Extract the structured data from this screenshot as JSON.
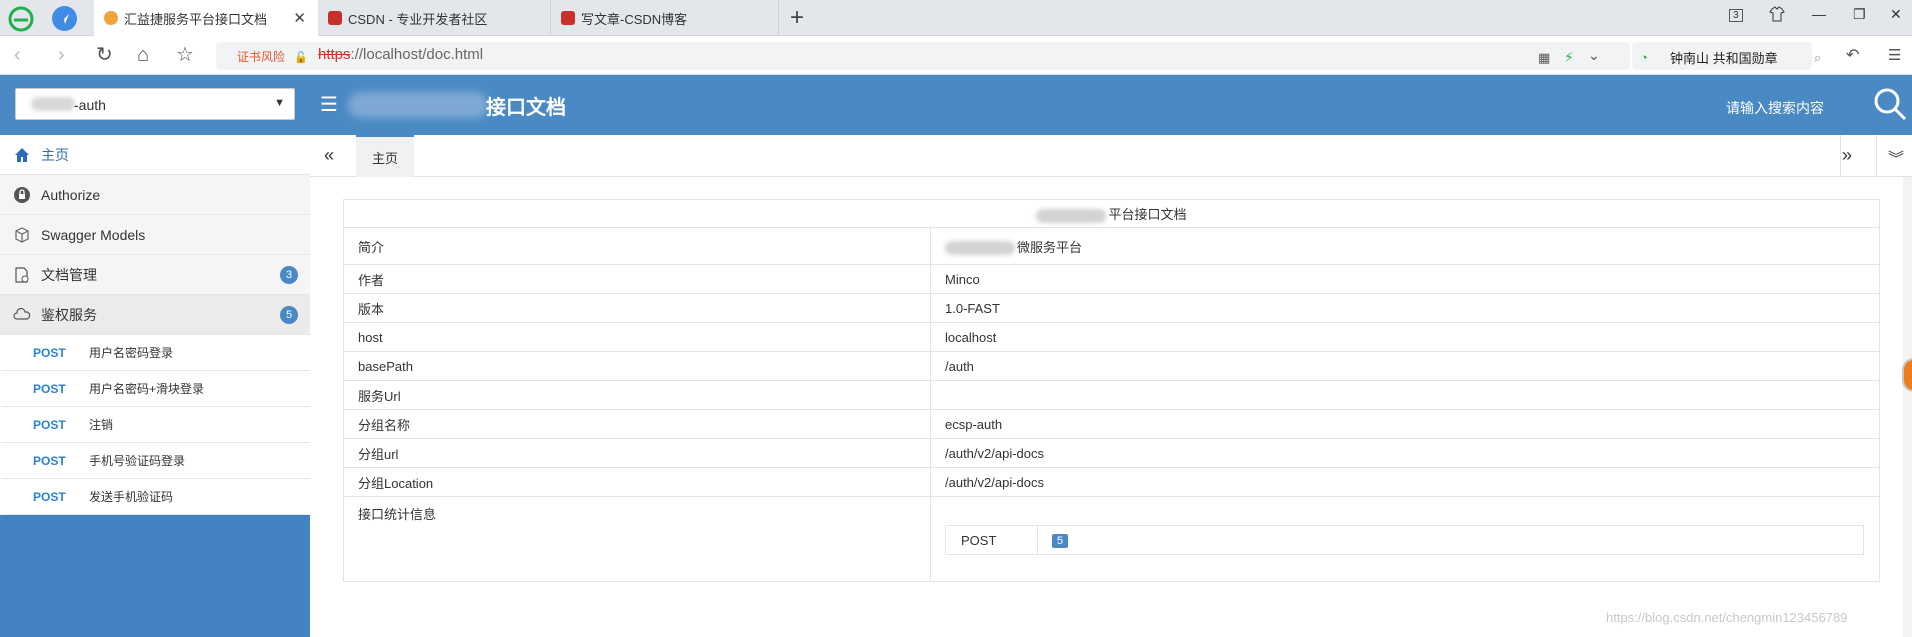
{
  "browser": {
    "tabs": [
      {
        "title": "汇益捷服务平台接口文档",
        "active": true
      },
      {
        "title": "CSDN - 专业开发者社区"
      },
      {
        "title": "写文章-CSDN博客"
      }
    ],
    "tab_count": "3",
    "cert_warning": "证书风险",
    "url_scheme": "https",
    "url_rest": "://localhost/doc.html",
    "search_hint": "钟南山 共和国勋章",
    "colors": {
      "favicon_csdn": "#c9302c",
      "favicon_active": "#f0a33a"
    }
  },
  "header": {
    "group_select": "-auth",
    "title": "接口文档",
    "search_placeholder": "请输入搜索内容"
  },
  "sidebar": {
    "items": [
      {
        "label": "主页",
        "icon": "home-icon"
      },
      {
        "label": "Authorize",
        "icon": "lock-icon"
      },
      {
        "label": "Swagger Models",
        "icon": "cube-icon"
      },
      {
        "label": "文档管理",
        "icon": "document-gear-icon",
        "badge": "3"
      },
      {
        "label": "鉴权服务",
        "icon": "cloud-icon",
        "badge": "5"
      }
    ],
    "apis": [
      {
        "method": "POST",
        "name": "用户名密码登录"
      },
      {
        "method": "POST",
        "name": "用户名密码+滑块登录"
      },
      {
        "method": "POST",
        "name": "注销"
      },
      {
        "method": "POST",
        "name": "手机号验证码登录"
      },
      {
        "method": "POST",
        "name": "发送手机验证码"
      }
    ]
  },
  "content": {
    "tab_home": "主页",
    "doc_title": "平台接口文档",
    "rows": [
      {
        "key": "简介",
        "value": "微服务平台"
      },
      {
        "key": "作者",
        "value": "Minco"
      },
      {
        "key": "版本",
        "value": "1.0-FAST"
      },
      {
        "key": "host",
        "value": "localhost"
      },
      {
        "key": "basePath",
        "value": "/auth"
      },
      {
        "key": "服务Url",
        "value": ""
      },
      {
        "key": "分组名称",
        "value": "ecsp-auth"
      },
      {
        "key": "分组url",
        "value": "/auth/v2/api-docs"
      },
      {
        "key": "分组Location",
        "value": "/auth/v2/api-docs"
      }
    ],
    "stats_label": "接口统计信息",
    "stats": [
      {
        "method": "POST",
        "count": "5"
      }
    ]
  },
  "watermark": "https://blog.csdn.net/chengmin123456789"
}
